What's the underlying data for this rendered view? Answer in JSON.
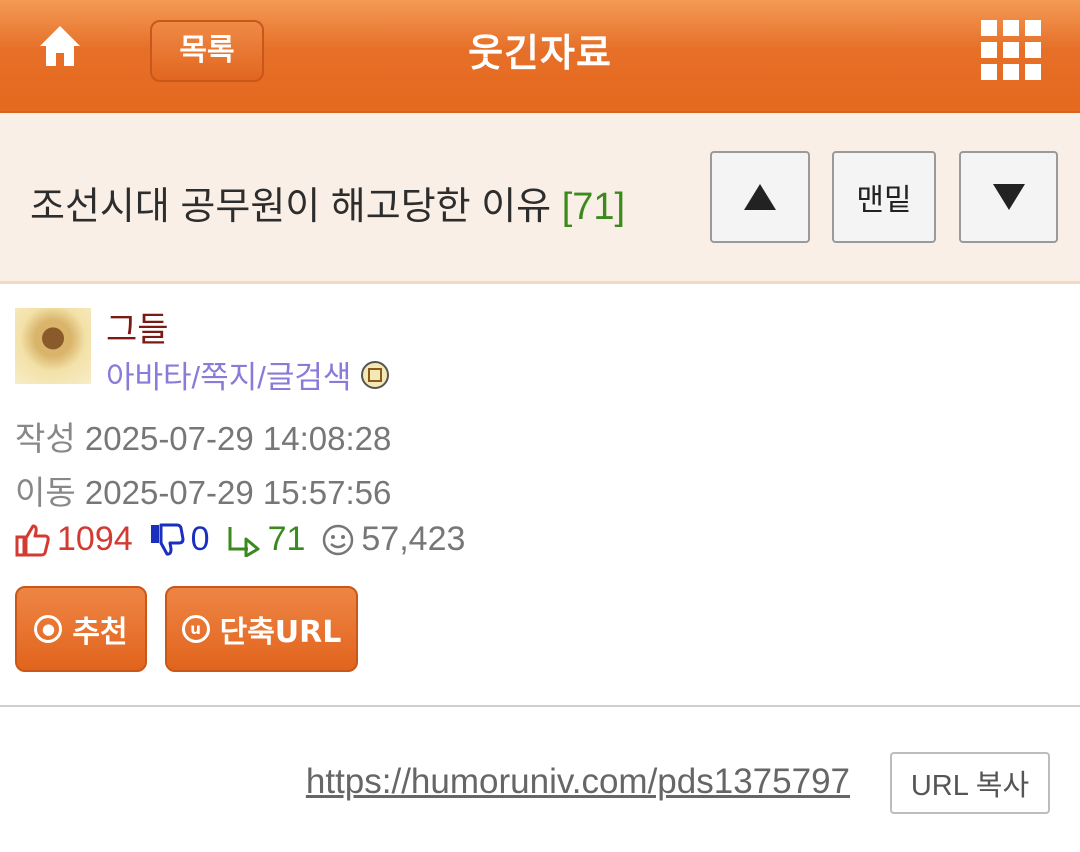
{
  "header": {
    "home_icon": "home-icon",
    "list_label": "목록",
    "title": "웃긴자료",
    "menu_icon": "grid-menu-icon"
  },
  "post": {
    "title": "조선시대 공무원이 해고당한 이유",
    "comment_count": "[71]",
    "nav": {
      "up_icon": "up-arrow-icon",
      "bottom_label": "맨밑",
      "down_icon": "down-arrow-icon"
    }
  },
  "author": {
    "name": "그들",
    "links": "아바타/쪽지/글검색"
  },
  "meta": {
    "written_label": "작성",
    "written_time": "2025-07-29 14:08:28",
    "moved_label": "이동",
    "moved_time": "2025-07-29 15:57:56"
  },
  "stats": {
    "upvotes": "1094",
    "downvotes": "0",
    "replies": "71",
    "views": "57,423"
  },
  "actions": {
    "recommend_label": "추천",
    "recommend_icon_text": "◎",
    "short_url_label": "단축URL",
    "short_url_icon_text": "u"
  },
  "url": {
    "link": "https://humoruniv.com/pds1375797",
    "copy_label": "URL 복사"
  },
  "colors": {
    "header_orange": "#e66f28",
    "title_bg": "#f9efe6",
    "comment_green": "#3c8a1e",
    "upvote_red": "#d23a32",
    "downvote_blue": "#1a2fc0",
    "author_red": "#7a1a12",
    "link_purple": "#8a7bd9"
  }
}
